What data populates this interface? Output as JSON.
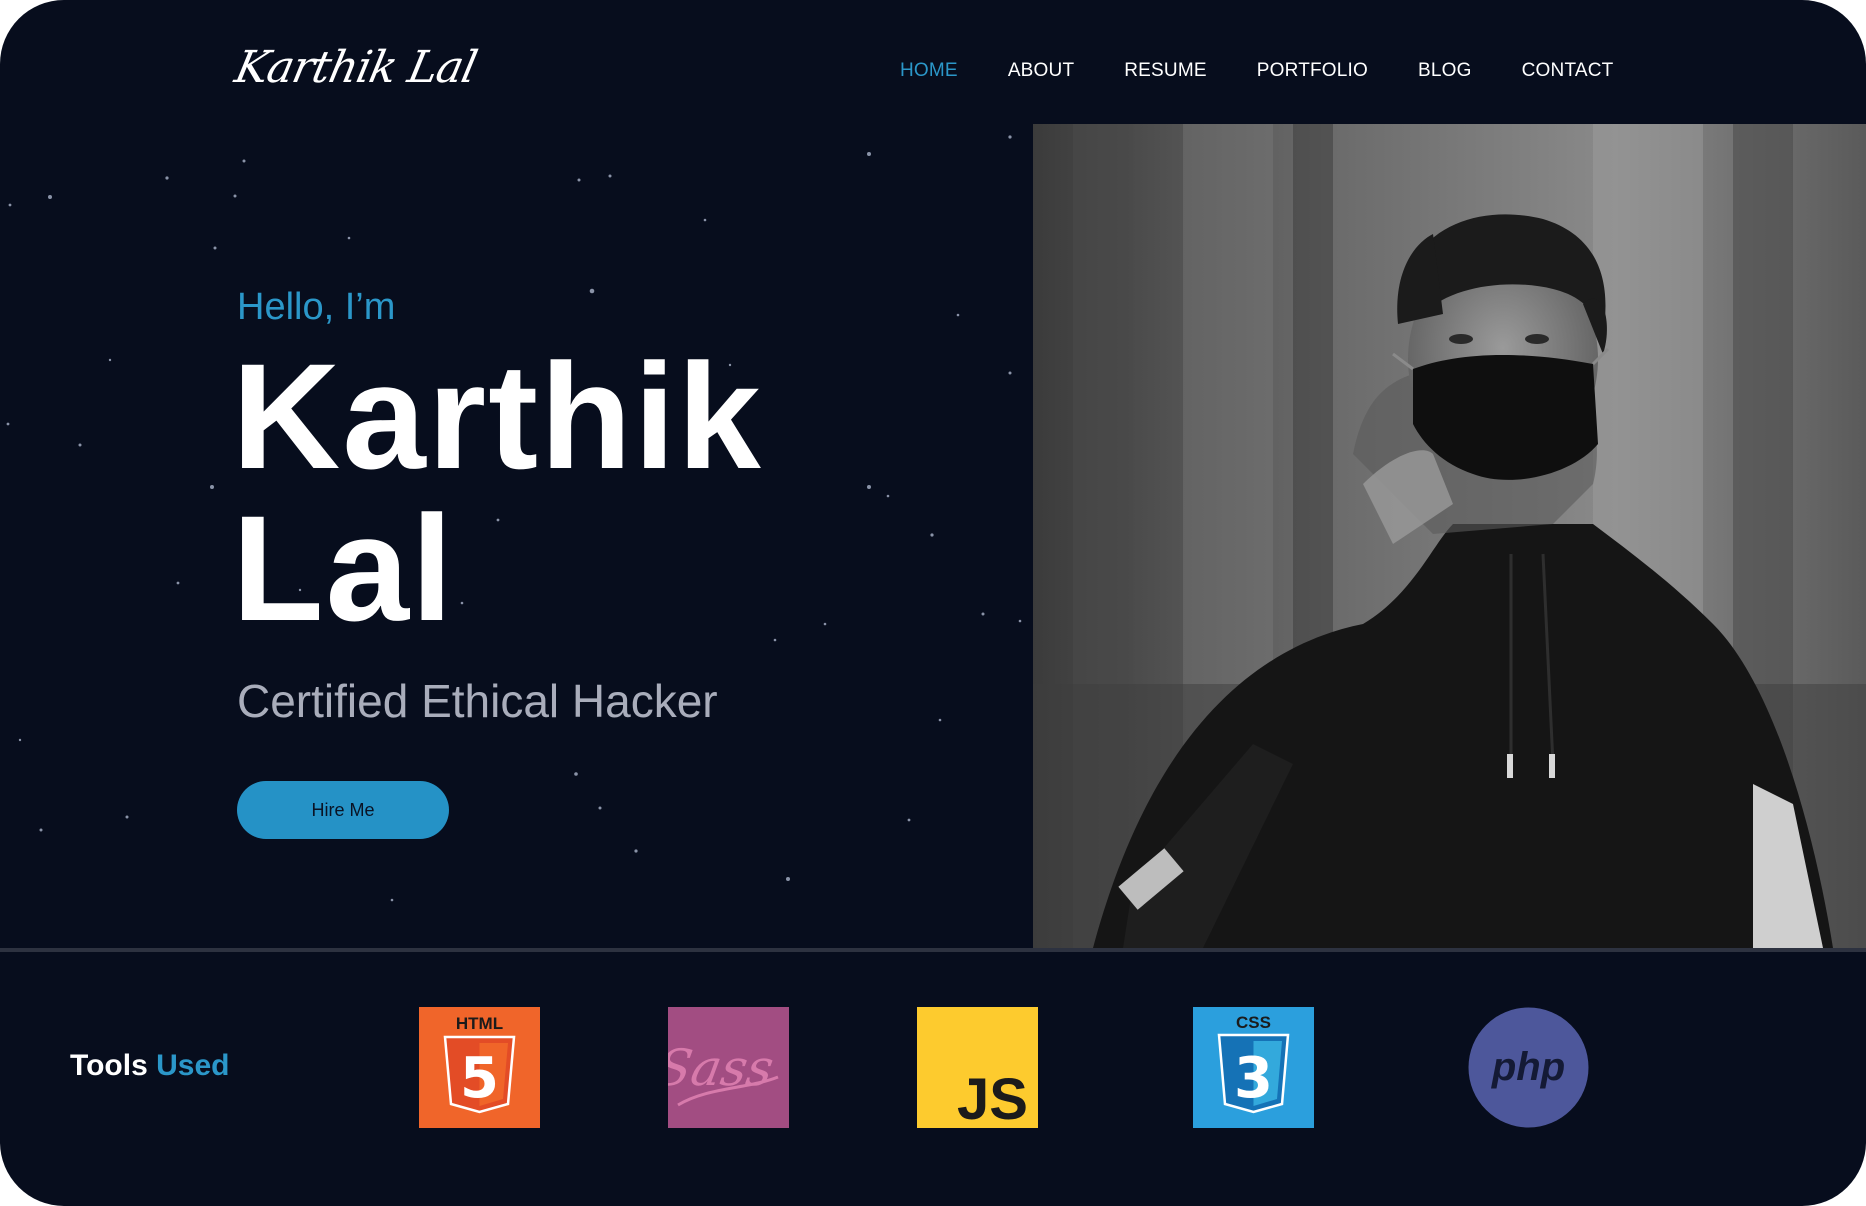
{
  "logo": {
    "text": "Karthik Lal"
  },
  "nav": {
    "items": [
      {
        "label": "HOME",
        "active": true
      },
      {
        "label": "ABOUT"
      },
      {
        "label": "RESUME"
      },
      {
        "label": "PORTFOLIO"
      },
      {
        "label": "BLOG"
      },
      {
        "label": "CONTACT"
      }
    ]
  },
  "hero": {
    "greeting": "Hello, I’m",
    "name_line1": "Karthik",
    "name_line2": "Lal",
    "role": "Certified Ethical Hacker",
    "cta_label": "Hire Me"
  },
  "tools": {
    "title_word1": "Tools",
    "title_word2": "Used",
    "items": [
      {
        "icon": "html5-icon",
        "label": "HTML",
        "glyph": "5",
        "color": "#f0652a"
      },
      {
        "icon": "sass-icon",
        "label": "Sass",
        "color": "#a24d82"
      },
      {
        "icon": "javascript-icon",
        "label": "JS",
        "color": "#fdcb2e"
      },
      {
        "icon": "css3-icon",
        "label": "CSS",
        "glyph": "3",
        "color": "#2b9fdd"
      },
      {
        "icon": "php-icon",
        "label": "php",
        "color": "#4d579b"
      }
    ]
  },
  "colors": {
    "background": "#070d1d",
    "accent": "#2b97c9",
    "button": "#2592c6",
    "role_text": "#a9adbb"
  }
}
